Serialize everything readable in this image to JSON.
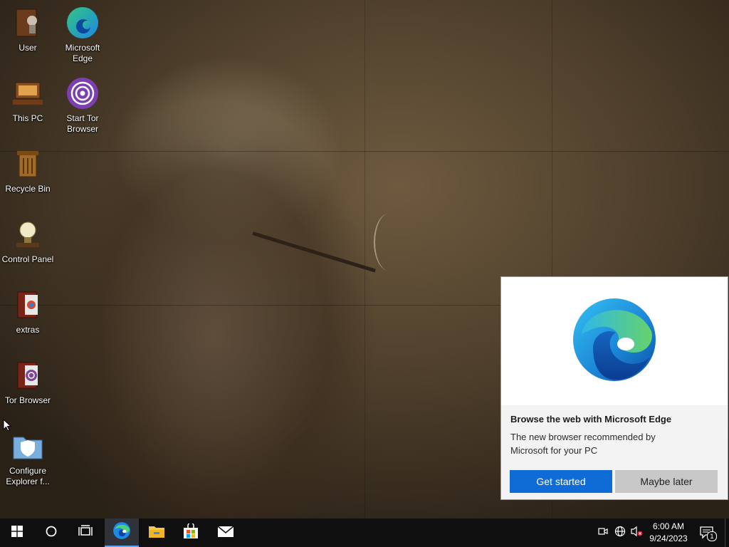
{
  "desktop": {
    "icons": [
      {
        "label": "User",
        "icon": "user-folder-icon"
      },
      {
        "label": "Microsoft Edge",
        "icon": "edge-icon"
      },
      {
        "label": "This PC",
        "icon": "this-pc-icon"
      },
      {
        "label": "Start Tor Browser",
        "icon": "tor-icon"
      },
      {
        "label": "Recycle Bin",
        "icon": "recycle-bin-icon"
      },
      {
        "label": "Control Panel",
        "icon": "control-panel-icon"
      },
      {
        "label": "extras",
        "icon": "folder-icon"
      },
      {
        "label": "Tor Browser",
        "icon": "tor-folder-icon"
      },
      {
        "label": "Configure Explorer f...",
        "icon": "shield-folder-icon"
      }
    ]
  },
  "toast": {
    "title": "Browse the web with Microsoft Edge",
    "body": "The new browser recommended by Microsoft for your PC",
    "primary_button": "Get started",
    "secondary_button": "Maybe later",
    "hero_icon": "edge-logo-icon"
  },
  "taskbar": {
    "items": [
      "start-icon",
      "search-icon",
      "task-view-icon",
      "edge-icon",
      "file-explorer-icon",
      "store-icon",
      "mail-icon"
    ],
    "tray_icons": [
      "meet-now-icon",
      "network-icon",
      "volume-muted-icon"
    ],
    "clock": {
      "time": "6:00 AM",
      "date": "9/24/2023"
    },
    "notification_count": "1"
  },
  "colors": {
    "accent": "#0f6cd6",
    "taskbar": "#0f0f10",
    "secondary_button": "#c8c8c8"
  }
}
